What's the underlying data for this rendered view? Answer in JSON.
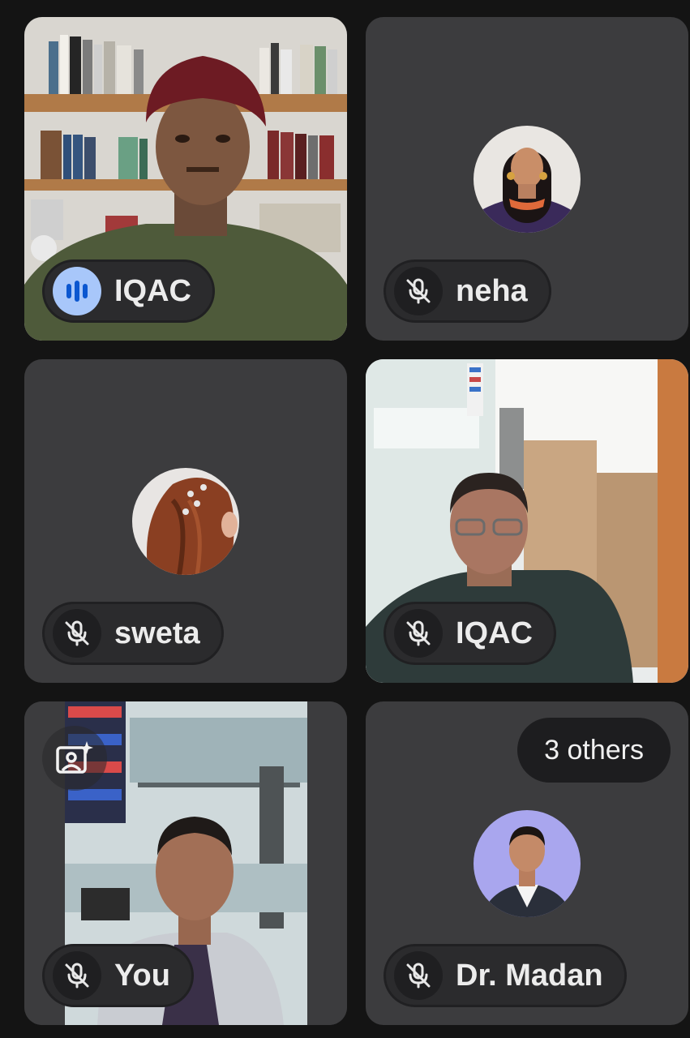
{
  "participants": [
    {
      "name": "IQAC",
      "state": "speaking",
      "view": "video",
      "mic_icon": "audio-level-icon"
    },
    {
      "name": "neha",
      "state": "muted",
      "view": "avatar",
      "mic_icon": "mic-off-icon"
    },
    {
      "name": "sweta",
      "state": "muted",
      "view": "avatar",
      "mic_icon": "mic-off-icon"
    },
    {
      "name": "IQAC",
      "state": "muted",
      "view": "video",
      "mic_icon": "mic-off-icon"
    },
    {
      "name": "You",
      "state": "muted",
      "view": "video",
      "mic_icon": "mic-off-icon",
      "effects_icon": "camera-effects-icon"
    },
    {
      "name": "Dr. Madan",
      "state": "muted",
      "view": "avatar",
      "mic_icon": "mic-off-icon"
    }
  ],
  "others_chip": {
    "label": "3 others"
  },
  "colors": {
    "background": "#141414",
    "tile": "#3c3c3e",
    "pill": "#2b2b2d",
    "speaking_badge": "#a8c7fa",
    "speaking_bars": "#0b57d0",
    "text": "#ececec"
  }
}
